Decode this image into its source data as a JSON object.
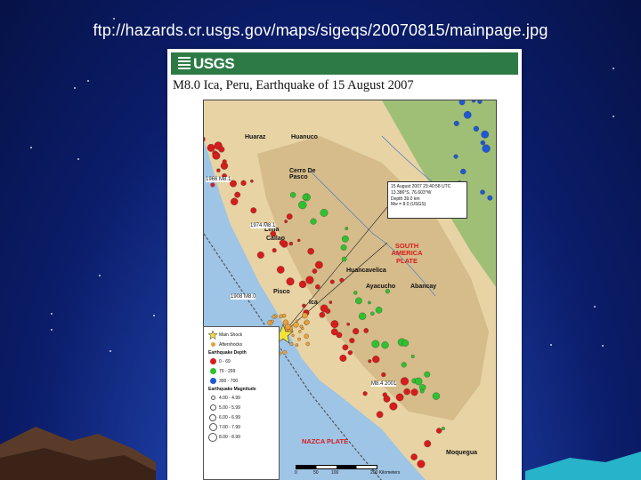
{
  "slide": {
    "caption": "ftp://hazards.cr.usgs.gov/maps/sigeqs/20070815/mainpage.jpg"
  },
  "poster": {
    "agency": "USGS",
    "title": "M8.0 Ica, Peru, Earthquake of 15 August 2007"
  },
  "map": {
    "cities": [
      "Huaraz",
      "Huanuco",
      "Cerro De Pasco",
      "Lima",
      "Callao",
      "Huancavelica",
      "Ayacucho",
      "Pisco",
      "Ica",
      "Abancay",
      "Moquegua"
    ],
    "historic_quakes": [
      "1966 M8.1",
      "1974 M8.1",
      "1908 M8.0",
      "M8.4 2001"
    ],
    "plates": {
      "south_america": "SOUTH AMERICA PLATE",
      "nazca": "NAZCA PLATE"
    },
    "info_box": [
      "15 August 2007 23:40:58 UTC",
      "13.386°S, 76.603°W",
      "Depth 39.0 km",
      "Mw = 8.0 (USGS)"
    ]
  },
  "legend": {
    "main_shock": "Main Shock",
    "aftershocks": "Aftershocks",
    "depth_heading": "Earthquake Depth",
    "depths": [
      {
        "label": "0 - 69",
        "color": "#d81b1b"
      },
      {
        "label": "70 - 299",
        "color": "#2fc12f"
      },
      {
        "label": "300 - 700",
        "color": "#1f57d6"
      }
    ],
    "magnitude_heading": "Earthquake Magnitude",
    "magnitudes": [
      "4.00 - 4.99",
      "5.00 - 5.99",
      "6.00 - 6.99",
      "7.00 - 7.99",
      "8.00 - 8.99"
    ]
  },
  "scale": {
    "labels": [
      "0",
      "50",
      "100",
      "200 Kilometers"
    ]
  },
  "colors": {
    "usgs_green": "#2e7a46",
    "shallow": "#d81b1b",
    "intermediate": "#2fc12f",
    "deep": "#1f57d6",
    "main_shock": "#f3e23a"
  }
}
